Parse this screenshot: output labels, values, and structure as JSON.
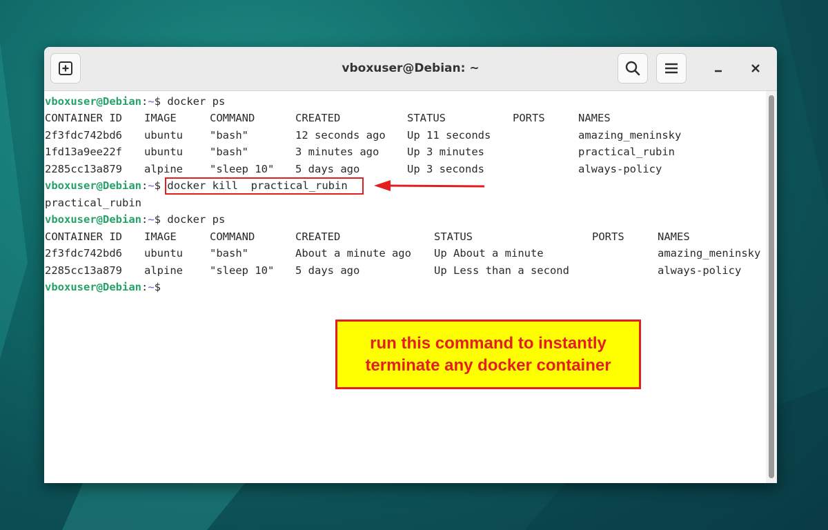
{
  "window": {
    "title": "vboxuser@Debian: ~",
    "buttons": {
      "new_tab_icon": "plus-square-icon",
      "search_icon": "search-icon",
      "menu_icon": "hamburger-menu-icon",
      "minimize_icon": "minimize-icon",
      "close_icon": "close-icon"
    }
  },
  "colors": {
    "prompt_user": "#26a269",
    "prompt_path": "#5b5bd6",
    "annotation_red": "#e41e1e",
    "callout_bg": "#ffff00"
  },
  "prompt": {
    "user_host": "vboxuser@Debian",
    "sep": ":",
    "path": "~",
    "symbol": "$"
  },
  "session": {
    "cmd1": "docker ps",
    "table1": {
      "header": [
        "CONTAINER ID",
        "IMAGE",
        "COMMAND",
        "CREATED",
        "STATUS",
        "PORTS",
        "NAMES"
      ],
      "rows": [
        [
          "2f3fdc742bd6",
          "ubuntu",
          "\"bash\"",
          "12 seconds ago",
          "Up 11 seconds",
          "",
          "amazing_meninsky"
        ],
        [
          "1fd13a9ee22f",
          "ubuntu",
          "\"bash\"",
          "3 minutes ago",
          "Up 3 minutes",
          "",
          "practical_rubin"
        ],
        [
          "2285cc13a879",
          "alpine",
          "\"sleep 10\"",
          "5 days ago",
          "Up 3 seconds",
          "",
          "always-policy"
        ]
      ]
    },
    "cmd2": "docker kill  practical_rubin",
    "cmd2_output": "practical_rubin",
    "cmd3": "docker ps",
    "table2": {
      "header": [
        "CONTAINER ID",
        "IMAGE",
        "COMMAND",
        "CREATED",
        "STATUS",
        "PORTS",
        "NAMES"
      ],
      "rows": [
        [
          "2f3fdc742bd6",
          "ubuntu",
          "\"bash\"",
          "About a minute ago",
          "Up About a minute",
          "",
          "amazing_meninsky"
        ],
        [
          "2285cc13a879",
          "alpine",
          "\"sleep 10\"",
          "5 days ago",
          "Up Less than a second",
          "",
          "always-policy"
        ]
      ]
    }
  },
  "annotation": {
    "callout_line1": "run this command to instantly",
    "callout_line2": "terminate any docker container"
  }
}
